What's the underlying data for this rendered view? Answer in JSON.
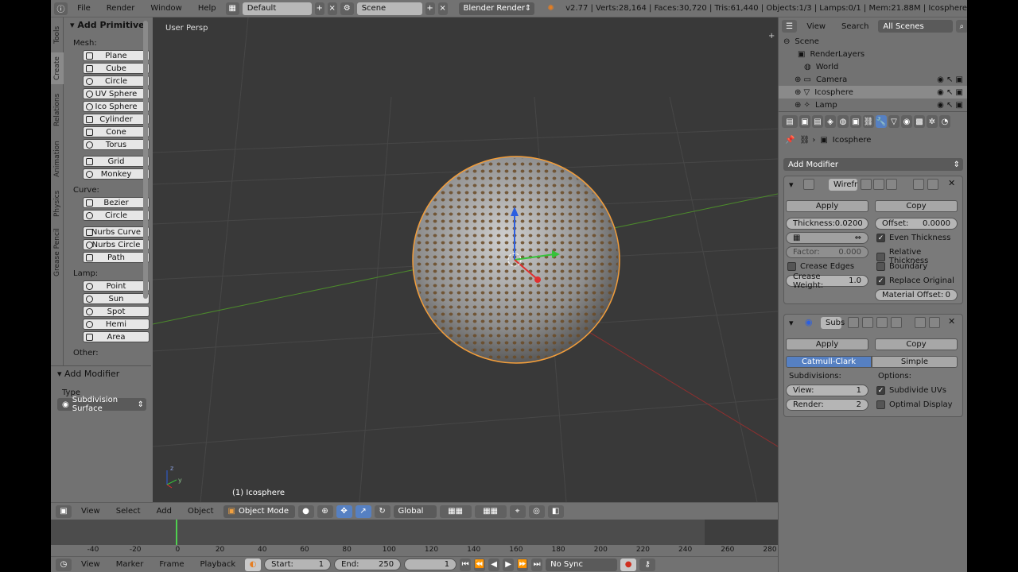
{
  "menu": {
    "file": "File",
    "render": "Render",
    "window": "Window",
    "help": "Help"
  },
  "layout": {
    "screen": "Default",
    "scene": "Scene",
    "engine": "Blender Render"
  },
  "stats": "v2.77 | Verts:28,164 | Faces:30,720 | Tris:61,440 | Objects:1/3 | Lamps:0/1 | Mem:21.88M | Icosphere",
  "tool_tabs": [
    "Tools",
    "Create",
    "Relations",
    "Animation",
    "Physics",
    "Grease Pencil"
  ],
  "toolshelf": {
    "title": "Add Primitive",
    "mesh_label": "Mesh:",
    "mesh": [
      "Plane",
      "Cube",
      "Circle",
      "UV Sphere",
      "Ico Sphere",
      "Cylinder",
      "Cone",
      "Torus",
      "Grid",
      "Monkey"
    ],
    "curve_label": "Curve:",
    "curve": [
      "Bezier",
      "Circle",
      "Nurbs Curve",
      "Nurbs Circle",
      "Path"
    ],
    "lamp_label": "Lamp:",
    "lamp": [
      "Point",
      "Sun",
      "Spot",
      "Hemi",
      "Area"
    ],
    "other_label": "Other:"
  },
  "operator": {
    "title": "Add Modifier",
    "type_label": "Type",
    "type_value": "Subdivision Surface"
  },
  "viewport": {
    "view_label": "User Persp",
    "object_label": "(1) Icosphere",
    "axis_y": "y",
    "axis_z": "z"
  },
  "view_header": {
    "view": "View",
    "select": "Select",
    "add": "Add",
    "object": "Object",
    "mode": "Object Mode",
    "orientation": "Global"
  },
  "timeline": {
    "ticks": [
      "-40",
      "-20",
      "0",
      "20",
      "40",
      "60",
      "80",
      "100",
      "120",
      "140",
      "160",
      "180",
      "200",
      "220",
      "240",
      "260",
      "280"
    ],
    "view": "View",
    "marker": "Marker",
    "frame": "Frame",
    "playback": "Playback",
    "start_label": "Start:",
    "start": "1",
    "end_label": "End:",
    "end": "250",
    "current": "1",
    "sync": "No Sync"
  },
  "outliner": {
    "view": "View",
    "search": "Search",
    "filter": "All Scenes",
    "items": [
      "Scene",
      "RenderLayers",
      "World",
      "Camera",
      "Icosphere",
      "Lamp"
    ]
  },
  "properties": {
    "object": "Icosphere",
    "add_modifier": "Add Modifier",
    "wire": {
      "name": "Wirefr",
      "apply": "Apply",
      "copy": "Copy",
      "thickness_label": "Thickness:",
      "thickness": "0.0200",
      "offset_label": "Offset:",
      "offset": "0.0000",
      "factor_label": "Factor:",
      "factor": "0.000",
      "even": "Even Thickness",
      "relative": "Relative Thickness",
      "crease_edges": "Crease Edges",
      "boundary": "Boundary",
      "crease_weight_label": "Crease Weight:",
      "crease_weight": "1.0",
      "replace": "Replace Original",
      "material_offset_label": "Material Offset:",
      "material_offset": "0"
    },
    "subsurf": {
      "name": "Subs",
      "apply": "Apply",
      "copy": "Copy",
      "catmull": "Catmull-Clark",
      "simple": "Simple",
      "subdiv_label": "Subdivisions:",
      "options_label": "Options:",
      "view_label": "View:",
      "view": "1",
      "render_label": "Render:",
      "render": "2",
      "subdivide_uvs": "Subdivide UVs",
      "optimal": "Optimal Display"
    }
  },
  "colors": {
    "viewport_bg": "#393939",
    "accent": "#5680c2",
    "selected_outline": "#f29d3a",
    "grid_x": "#8e2f2f",
    "grid_y": "#4c8a2c"
  }
}
